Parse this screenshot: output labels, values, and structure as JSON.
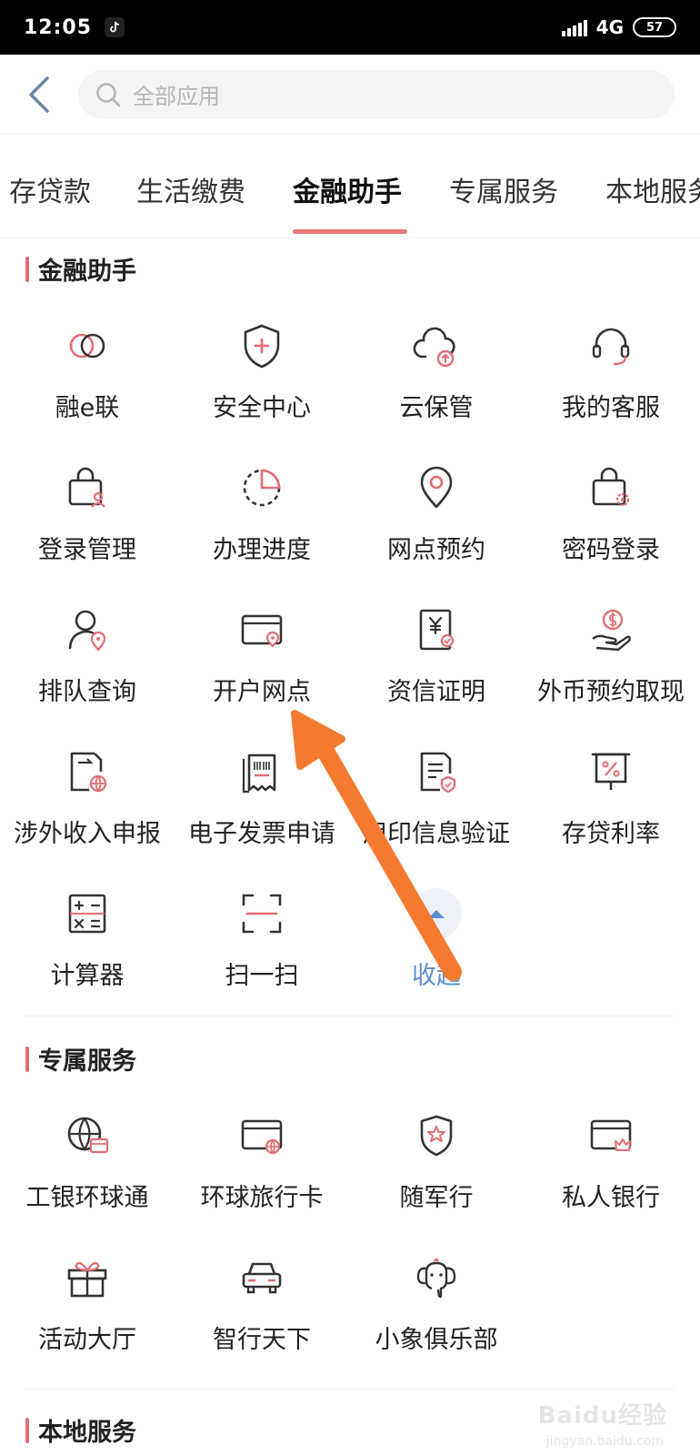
{
  "status_bar": {
    "time": "12:05",
    "network": "4G",
    "battery": "57"
  },
  "search": {
    "placeholder": "全部应用"
  },
  "tabs": [
    {
      "label": "存贷款"
    },
    {
      "label": "生活缴费"
    },
    {
      "label": "金融助手",
      "active": true
    },
    {
      "label": "专属服务"
    },
    {
      "label": "本地服务"
    }
  ],
  "sections": {
    "finance": {
      "title": "金融助手",
      "items": [
        {
          "label": "融e联",
          "icon": "rong-e-lian-icon"
        },
        {
          "label": "安全中心",
          "icon": "shield-plus-icon"
        },
        {
          "label": "云保管",
          "icon": "cloud-upload-icon"
        },
        {
          "label": "我的客服",
          "icon": "headset-icon"
        },
        {
          "label": "登录管理",
          "icon": "lock-user-icon"
        },
        {
          "label": "办理进度",
          "icon": "progress-pie-icon"
        },
        {
          "label": "网点预约",
          "icon": "location-pin-icon"
        },
        {
          "label": "密码登录",
          "icon": "lock-gear-icon"
        },
        {
          "label": "排队查询",
          "icon": "person-pin-icon"
        },
        {
          "label": "开户网点",
          "icon": "card-pin-icon"
        },
        {
          "label": "资信证明",
          "icon": "yuan-certificate-icon"
        },
        {
          "label": "外币预约取现",
          "icon": "dollar-hand-icon"
        },
        {
          "label": "涉外收入申报",
          "icon": "document-globe-icon"
        },
        {
          "label": "电子发票申请",
          "icon": "receipt-icon"
        },
        {
          "label": "用印信息验证",
          "icon": "document-check-icon"
        },
        {
          "label": "存贷利率",
          "icon": "percent-board-icon"
        },
        {
          "label": "计算器",
          "icon": "calculator-icon"
        },
        {
          "label": "扫一扫",
          "icon": "scan-icon"
        },
        {
          "label": "收起",
          "icon": "chevron-up-icon"
        }
      ]
    },
    "exclusive": {
      "title": "专属服务",
      "items": [
        {
          "label": "工银环球通",
          "icon": "globe-card-icon"
        },
        {
          "label": "环球旅行卡",
          "icon": "card-globe-icon"
        },
        {
          "label": "随军行",
          "icon": "badge-star-icon"
        },
        {
          "label": "私人银行",
          "icon": "card-crown-icon"
        },
        {
          "label": "活动大厅",
          "icon": "gift-icon"
        },
        {
          "label": "智行天下",
          "icon": "car-icon"
        },
        {
          "label": "小象俱乐部",
          "icon": "elephant-icon"
        }
      ]
    },
    "local": {
      "title": "本地服务"
    }
  },
  "watermark": {
    "main": "Baidu经验",
    "sub": "jingyan.baidu.com"
  },
  "colors": {
    "accent": "#e26d72",
    "icon_stroke": "#333333",
    "icon_accent": "#e26d72",
    "collapse_blue": "#5b8fd2",
    "annotation_arrow": "#f47a30"
  }
}
